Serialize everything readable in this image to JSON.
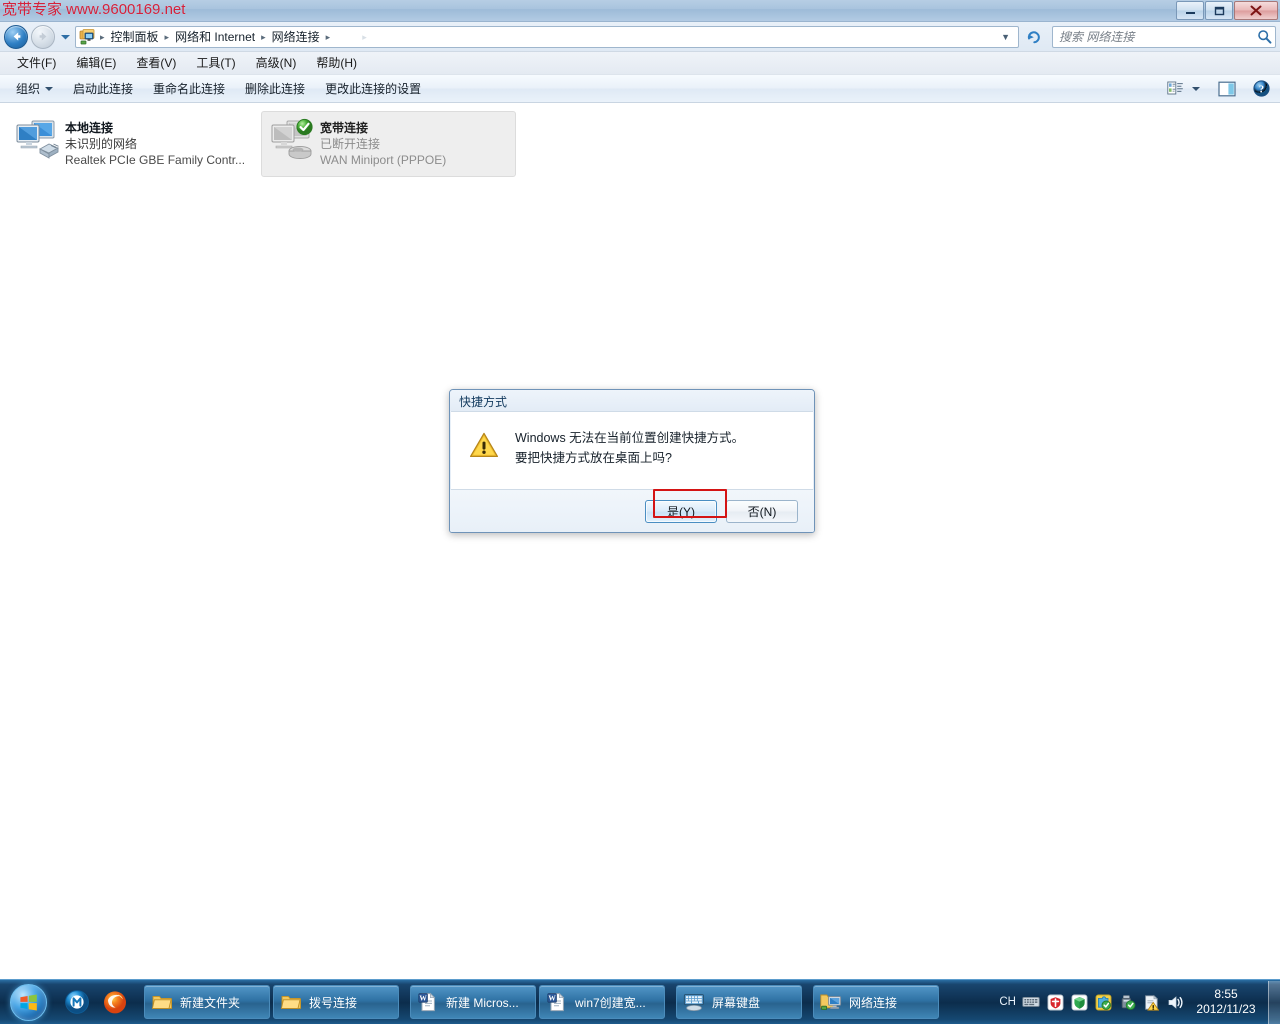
{
  "window": {
    "watermark": "宽带专家 www.9600169.net",
    "controls": {
      "minimize": "最小化",
      "maximize": "最大化",
      "close": "关闭"
    }
  },
  "address_bar": {
    "crumbs": [
      "控制面板",
      "网络和 Internet",
      "网络连接"
    ],
    "separator": "▸",
    "faded_crumbs": [
      "",
      ""
    ],
    "back_label": "后退",
    "forward_label": "前进",
    "history_label": "最近浏览的位置",
    "refresh_label": "刷新",
    "icon": "network-folder-icon"
  },
  "search": {
    "placeholder": "搜索 网络连接",
    "icon": "search-icon"
  },
  "menubar": {
    "items": [
      {
        "label": "文件(F)",
        "name": "menu-file"
      },
      {
        "label": "编辑(E)",
        "name": "menu-edit"
      },
      {
        "label": "查看(V)",
        "name": "menu-view"
      },
      {
        "label": "工具(T)",
        "name": "menu-tools"
      },
      {
        "label": "高级(N)",
        "name": "menu-advanced"
      },
      {
        "label": "帮助(H)",
        "name": "menu-help"
      }
    ]
  },
  "toolbar": {
    "organize": "组织",
    "items": [
      {
        "label": "启动此连接",
        "name": "toolbar-start-connection"
      },
      {
        "label": "重命名此连接",
        "name": "toolbar-rename-connection"
      },
      {
        "label": "删除此连接",
        "name": "toolbar-delete-connection"
      },
      {
        "label": "更改此连接的设置",
        "name": "toolbar-change-settings"
      }
    ],
    "view_icon": "view-options-icon",
    "preview_icon": "preview-pane-icon",
    "help_icon": "help-icon"
  },
  "connections": [
    {
      "name": "本地连接",
      "status": "未识别的网络",
      "device": "Realtek PCIe GBE Family Contr...",
      "selected": false,
      "icon": "lan-connection-icon"
    },
    {
      "name": "宽带连接",
      "status": "已断开连接",
      "device": "WAN Miniport (PPPOE)",
      "selected": true,
      "icon": "broadband-connection-icon"
    }
  ],
  "dialog": {
    "title": "快捷方式",
    "icon": "warning-icon",
    "message_line1": "Windows 无法在当前位置创建快捷方式。",
    "message_line2": "要把快捷方式放在桌面上吗?",
    "yes_label": "是(Y)",
    "no_label": "否(N)",
    "highlight_color": "#d41414"
  },
  "taskbar": {
    "start_label": "开始",
    "quick_launch": [
      {
        "name": "maxthon-icon",
        "label": "Maxthon"
      },
      {
        "name": "firefox-icon",
        "label": "Firefox"
      }
    ],
    "buttons": [
      {
        "label": "新建文件夹",
        "icon": "folder-icon",
        "name": "taskbar-new-folder"
      },
      {
        "label": "拨号连接",
        "icon": "folder-icon",
        "name": "taskbar-dialup"
      },
      {
        "label": "新建 Micros...",
        "icon": "word-doc-icon",
        "name": "taskbar-word-new"
      },
      {
        "label": "win7创建宽...",
        "icon": "word-doc-icon",
        "name": "taskbar-word-win7"
      },
      {
        "label": "屏幕键盘",
        "icon": "onscreen-keyboard-icon",
        "name": "taskbar-osk"
      },
      {
        "label": "网络连接",
        "icon": "network-folder-icon",
        "name": "taskbar-network-connections"
      }
    ],
    "tray": {
      "language": "CH",
      "icons": [
        "ime-keyboard-icon",
        "shield-red-icon",
        "green-shield-icon",
        "puzzle-green-icon",
        "usb-safe-remove-icon",
        "action-center-warning-icon",
        "volume-icon"
      ],
      "time": "8:55",
      "date": "2012/11/23",
      "show_desktop_label": "显示桌面"
    }
  }
}
